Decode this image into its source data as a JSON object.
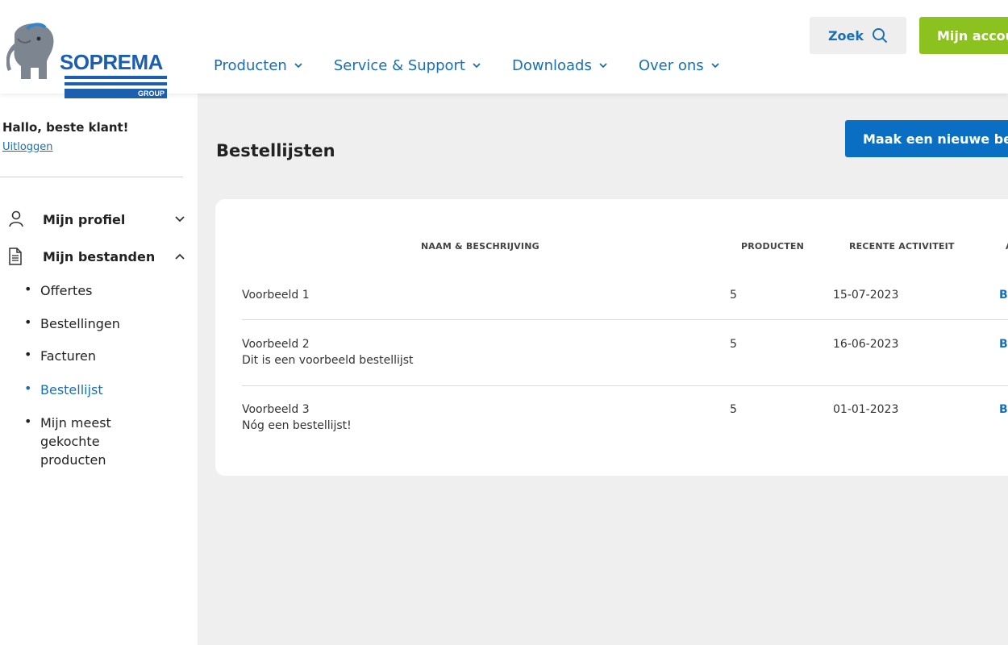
{
  "header": {
    "logo": {
      "name": "SOPREMA",
      "sub": "GROUP"
    },
    "nav": [
      {
        "label": "Producten"
      },
      {
        "label": "Service & Support"
      },
      {
        "label": "Downloads"
      },
      {
        "label": "Over ons"
      }
    ],
    "search_label": "Zoek",
    "account_label": "Mijn accou",
    "colors": {
      "brand": "#1b5fae",
      "link": "#1a6fb4",
      "account": "#8cc21f"
    }
  },
  "sidebar": {
    "greeting": "Hallo, beste klant!",
    "logout": "Uitloggen",
    "menu": [
      {
        "label": "Mijn profiel",
        "icon": "user-icon",
        "expanded": false
      },
      {
        "label": "Mijn bestanden",
        "icon": "document-icon",
        "expanded": true
      }
    ],
    "files_items": [
      {
        "label": "Offertes"
      },
      {
        "label": "Bestellingen"
      },
      {
        "label": "Facturen"
      },
      {
        "label": "Bestellijst"
      },
      {
        "label": "Mijn meest gekochte producten"
      }
    ]
  },
  "main": {
    "title": "Bestellijsten",
    "new_button": "Maak een nieuwe beste",
    "table": {
      "headers": [
        "NAAM & BESCHRIJVING",
        "PRODUCTEN",
        "RECENTE ACTIVITEIT",
        "A"
      ],
      "rows": [
        {
          "name": "Voorbeeld 1",
          "description": "",
          "products": "5",
          "activity": "15-07-2023",
          "action": "Be"
        },
        {
          "name": "Voorbeeld 2",
          "description": "Dit is een voorbeeld bestellijst",
          "products": "5",
          "activity": "16-06-2023",
          "action": "Be"
        },
        {
          "name": "Voorbeeld 3",
          "description": "Nóg een bestellijst!",
          "products": "5",
          "activity": "01-01-2023",
          "action": "Be"
        }
      ]
    }
  }
}
